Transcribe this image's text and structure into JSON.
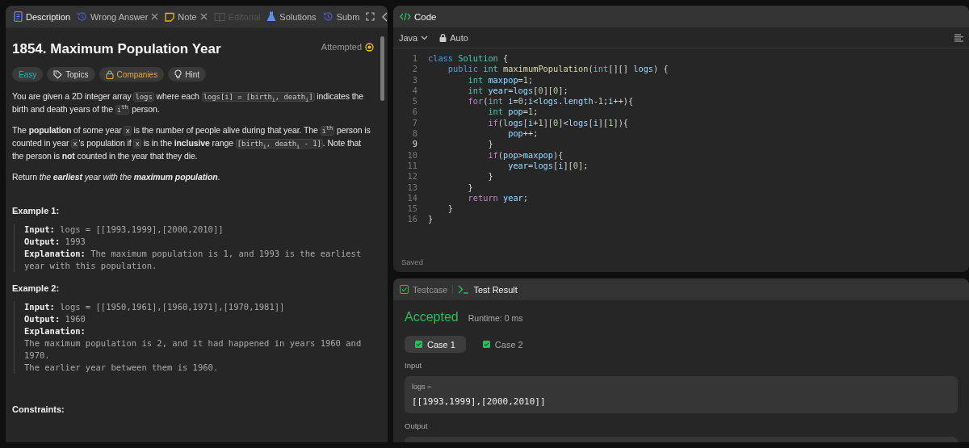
{
  "description": {
    "tabs": [
      {
        "label": "Description",
        "kind": "description",
        "selected": true,
        "closable": false,
        "disabled": false
      },
      {
        "label": "Wrong Answer",
        "kind": "submission",
        "selected": false,
        "closable": true,
        "disabled": false
      },
      {
        "label": "Note",
        "kind": "note",
        "selected": false,
        "closable": true,
        "disabled": false
      },
      {
        "label": "Editorial",
        "kind": "editorial",
        "selected": false,
        "closable": false,
        "disabled": true
      },
      {
        "label": "Solutions",
        "kind": "solutions",
        "selected": false,
        "closable": false,
        "disabled": false
      },
      {
        "label": "Subm",
        "kind": "submission",
        "selected": false,
        "closable": false,
        "disabled": false
      }
    ],
    "title": "1854. Maximum Population Year",
    "status": "Attempted",
    "tags": [
      {
        "label": "Easy",
        "kind": "difficulty"
      },
      {
        "label": "Topics",
        "kind": "topics"
      },
      {
        "label": "Companies",
        "kind": "companies"
      },
      {
        "label": "Hint",
        "kind": "hint"
      }
    ],
    "paragraphs": [
      [
        {
          "kind": "text",
          "text": "You are given a 2D integer array "
        },
        {
          "kind": "code",
          "text": "logs"
        },
        {
          "kind": "text",
          "text": " where each "
        },
        {
          "kind": "code",
          "text": "logs[i] = [birth$_{i}$, death$_{i}$]"
        },
        {
          "kind": "text",
          "text": " indicates the birth and death years of the "
        },
        {
          "kind": "code",
          "text": "i$^{th}$"
        },
        {
          "kind": "text",
          "text": " person."
        }
      ],
      [
        {
          "kind": "text",
          "text": "The **population** of some year "
        },
        {
          "kind": "code",
          "text": "x"
        },
        {
          "kind": "text",
          "text": " is the number of people alive during that year. The "
        },
        {
          "kind": "code",
          "text": "i$^{th}$"
        },
        {
          "kind": "text",
          "text": " person is counted in year "
        },
        {
          "kind": "code",
          "text": "x"
        },
        {
          "kind": "text",
          "text": "'s population if "
        },
        {
          "kind": "code",
          "text": "x"
        },
        {
          "kind": "text",
          "text": " is in the **inclusive** range "
        },
        {
          "kind": "code",
          "text": "[birth$_{i}$, death$_{i}$ - 1]"
        },
        {
          "kind": "text",
          "text": ". Note that the person is **not** counted in the year that they die."
        }
      ],
      [
        {
          "kind": "text",
          "text": "Return "
        },
        {
          "kind": "em",
          "text": "the "
        },
        {
          "kind": "strong-em",
          "text": "earliest"
        },
        {
          "kind": "em",
          "text": " year with the "
        },
        {
          "kind": "strong-em",
          "text": "maximum population"
        },
        {
          "kind": "text",
          "text": "."
        }
      ]
    ],
    "examples": [
      {
        "title": "Example 1:",
        "lines": [
          "**Input:** logs = [[1993,1999],[2000,2010]]",
          "**Output:** 1993",
          "**Explanation:** The maximum population is 1, and 1993 is the earliest year with this population."
        ]
      },
      {
        "title": "Example 2:",
        "lines": [
          "**Input:** logs = [[1950,1961],[1960,1971],[1970,1981]]",
          "**Output:** 1960",
          "**Explanation:**\nThe maximum population is 2, and it had happened in years 1960 and 1970.\nThe earlier year between them is 1960."
        ]
      }
    ],
    "constraints_title": "Constraints:"
  },
  "code": {
    "title": "Code",
    "language": "Java",
    "mode": "Auto",
    "status": "Saved",
    "lines": [
      {
        "n": "1",
        "current": false,
        "tokens": [
          {
            "kind": "kw",
            "text": "class"
          },
          {
            "kind": "type",
            "text": " Solution"
          },
          {
            "kind": "p",
            "text": " {"
          }
        ]
      },
      {
        "n": "2",
        "current": false,
        "tokens": [
          {
            "kind": "kw",
            "text": "    public"
          },
          {
            "kind": "type",
            "text": " int"
          },
          {
            "kind": "fn",
            "text": " maximumPopulation"
          },
          {
            "kind": "p",
            "text": "("
          },
          {
            "kind": "type",
            "text": "int"
          },
          {
            "kind": "p",
            "text": "[][]"
          },
          {
            "kind": "var",
            "text": " logs"
          },
          {
            "kind": "p",
            "text": ") {"
          }
        ]
      },
      {
        "n": "3",
        "current": false,
        "tokens": [
          {
            "kind": "type",
            "text": "        int"
          },
          {
            "kind": "var",
            "text": " maxpop"
          },
          {
            "kind": "p",
            "text": "="
          },
          {
            "kind": "num",
            "text": "1"
          },
          {
            "kind": "p",
            "text": ";"
          }
        ]
      },
      {
        "n": "4",
        "current": false,
        "tokens": [
          {
            "kind": "type",
            "text": "        int"
          },
          {
            "kind": "var",
            "text": " year"
          },
          {
            "kind": "p",
            "text": "="
          },
          {
            "kind": "var",
            "text": "logs"
          },
          {
            "kind": "p",
            "text": "["
          },
          {
            "kind": "num",
            "text": "0"
          },
          {
            "kind": "p",
            "text": "]["
          },
          {
            "kind": "num",
            "text": "0"
          },
          {
            "kind": "p",
            "text": "];"
          }
        ]
      },
      {
        "n": "5",
        "current": false,
        "tokens": [
          {
            "kind": "ctl",
            "text": "        for"
          },
          {
            "kind": "p",
            "text": "("
          },
          {
            "kind": "type",
            "text": "int"
          },
          {
            "kind": "var",
            "text": " i"
          },
          {
            "kind": "p",
            "text": "="
          },
          {
            "kind": "num",
            "text": "0"
          },
          {
            "kind": "p",
            "text": ";"
          },
          {
            "kind": "var",
            "text": "i"
          },
          {
            "kind": "p",
            "text": "<"
          },
          {
            "kind": "var",
            "text": "logs"
          },
          {
            "kind": "p",
            "text": "."
          },
          {
            "kind": "var",
            "text": "length"
          },
          {
            "kind": "p",
            "text": "-"
          },
          {
            "kind": "num",
            "text": "1"
          },
          {
            "kind": "p",
            "text": ";"
          },
          {
            "kind": "var",
            "text": "i"
          },
          {
            "kind": "p",
            "text": "++){"
          }
        ]
      },
      {
        "n": "6",
        "current": false,
        "tokens": [
          {
            "kind": "type",
            "text": "            int"
          },
          {
            "kind": "var",
            "text": " pop"
          },
          {
            "kind": "p",
            "text": "="
          },
          {
            "kind": "num",
            "text": "1"
          },
          {
            "kind": "p",
            "text": ";"
          }
        ]
      },
      {
        "n": "7",
        "current": false,
        "tokens": [
          {
            "kind": "ctl",
            "text": "            if"
          },
          {
            "kind": "p",
            "text": "("
          },
          {
            "kind": "var",
            "text": "logs"
          },
          {
            "kind": "p",
            "text": "["
          },
          {
            "kind": "var",
            "text": "i"
          },
          {
            "kind": "p",
            "text": "+"
          },
          {
            "kind": "num",
            "text": "1"
          },
          {
            "kind": "p",
            "text": "]["
          },
          {
            "kind": "num",
            "text": "0"
          },
          {
            "kind": "p",
            "text": "]<"
          },
          {
            "kind": "var",
            "text": "logs"
          },
          {
            "kind": "p",
            "text": "["
          },
          {
            "kind": "var",
            "text": "i"
          },
          {
            "kind": "p",
            "text": "]["
          },
          {
            "kind": "num",
            "text": "1"
          },
          {
            "kind": "p",
            "text": "]){"
          }
        ]
      },
      {
        "n": "8",
        "current": false,
        "tokens": [
          {
            "kind": "var",
            "text": "                pop"
          },
          {
            "kind": "p",
            "text": "++;"
          }
        ]
      },
      {
        "n": "9",
        "current": true,
        "tokens": [
          {
            "kind": "p",
            "text": "            }"
          }
        ]
      },
      {
        "n": "10",
        "current": false,
        "tokens": [
          {
            "kind": "ctl",
            "text": "            if"
          },
          {
            "kind": "p",
            "text": "("
          },
          {
            "kind": "var",
            "text": "pop"
          },
          {
            "kind": "p",
            "text": ">"
          },
          {
            "kind": "var",
            "text": "maxpop"
          },
          {
            "kind": "p",
            "text": "){"
          }
        ]
      },
      {
        "n": "11",
        "current": false,
        "tokens": [
          {
            "kind": "var",
            "text": "                year"
          },
          {
            "kind": "p",
            "text": "="
          },
          {
            "kind": "var",
            "text": "logs"
          },
          {
            "kind": "p",
            "text": "["
          },
          {
            "kind": "var",
            "text": "i"
          },
          {
            "kind": "p",
            "text": "]["
          },
          {
            "kind": "num",
            "text": "0"
          },
          {
            "kind": "p",
            "text": "];"
          }
        ]
      },
      {
        "n": "12",
        "current": false,
        "tokens": [
          {
            "kind": "p",
            "text": "            }"
          }
        ]
      },
      {
        "n": "13",
        "current": false,
        "tokens": [
          {
            "kind": "p",
            "text": "        }"
          }
        ]
      },
      {
        "n": "14",
        "current": false,
        "tokens": [
          {
            "kind": "ctl",
            "text": "        return"
          },
          {
            "kind": "var",
            "text": " year"
          },
          {
            "kind": "p",
            "text": ";"
          }
        ]
      },
      {
        "n": "15",
        "current": false,
        "tokens": [
          {
            "kind": "p",
            "text": "    }"
          }
        ]
      },
      {
        "n": "16",
        "current": false,
        "tokens": [
          {
            "kind": "p",
            "text": "}"
          }
        ]
      }
    ]
  },
  "result": {
    "tabs": [
      {
        "label": "Testcase",
        "kind": "testcase",
        "selected": false
      },
      {
        "label": "Test Result",
        "kind": "result",
        "selected": true
      }
    ],
    "verdict": "Accepted",
    "runtime": "Runtime: 0 ms",
    "cases": [
      {
        "label": "Case 1",
        "selected": true
      },
      {
        "label": "Case 2",
        "selected": false
      }
    ],
    "input_label": "Input",
    "param_name": "logs =",
    "param_value": "[[1993,1999],[2000,2010]]",
    "output_label": "Output"
  }
}
